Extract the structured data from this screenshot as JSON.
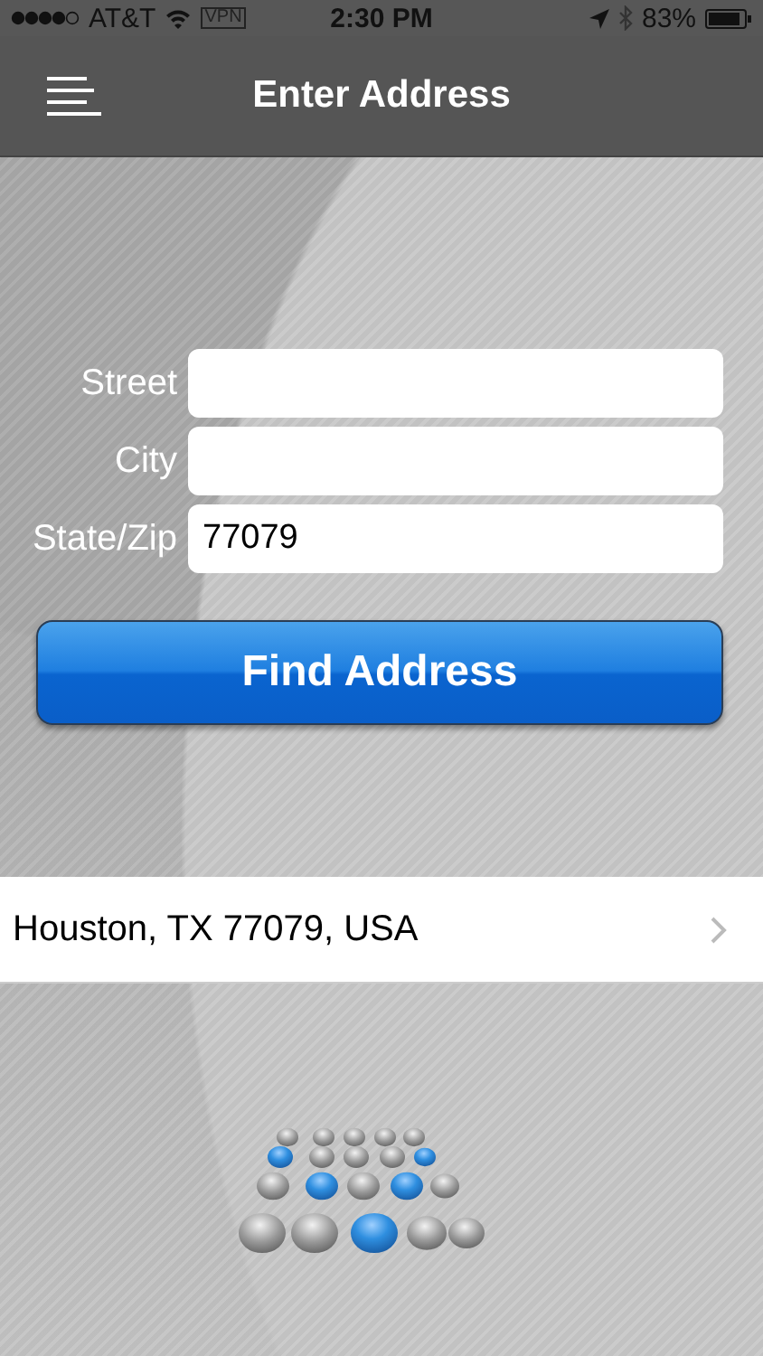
{
  "status_bar": {
    "carrier": "AT&T",
    "vpn": "VPN",
    "time": "2:30 PM",
    "battery": "83%"
  },
  "nav_bar": {
    "title": "Enter Address"
  },
  "form": {
    "fields": [
      {
        "label": "Street"
      },
      {
        "label": "City"
      },
      {
        "label": "State/Zip",
        "value": "77079"
      }
    ],
    "button": "Find Address"
  },
  "results": [
    {
      "text": "Houston, TX 77079, USA"
    }
  ]
}
